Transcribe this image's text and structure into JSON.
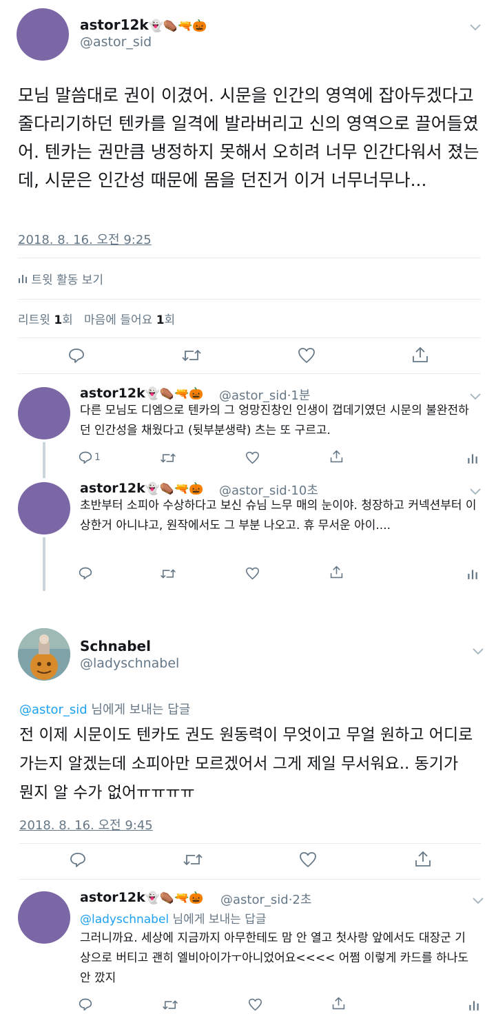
{
  "colors": {
    "accent": "#1da1f2",
    "gray": "#657786",
    "divider": "#e6ecf0",
    "avatar": "#7b66a6"
  },
  "main_tweet": {
    "name": "astor12k",
    "emojis": "👻⚰️🔫🎃",
    "handle": "@astor_sid",
    "text": "모님 말씀대로 권이 이겼어. 시문을 인간의 영역에 잡아두겠다고 줄다리기하던 텐카를 일격에 발라버리고 신의 영역으로 끌어들였어. 텐카는 권만큼 냉정하지 못해서 오히려 너무 인간다워서 졌는데, 시문은 인간성 때문에 몸을 던진거 이거 너무너무나...",
    "timestamp": "2018. 8. 16. 오전 9:25",
    "activity_label": "트윗 활동 보기",
    "retweet_label": "리트윗",
    "retweet_count": "1",
    "retweet_unit": "회",
    "like_label": "마음에 들어요",
    "like_count": "1",
    "like_unit": "회"
  },
  "replies_1": [
    {
      "name": "astor12k",
      "emojis": "👻⚰️🔫🎃",
      "handle": "@astor_sid",
      "time": "1분",
      "text": "다른 모님도 디엠으로 텐카의 그 엉망진창인 인생이 껍데기였던 시문의 불완전하던 인간성을 채웠다고 (뒷부분생략) 츠는 또 구르고.",
      "reply_count": "1"
    },
    {
      "name": "astor12k",
      "emojis": "👻⚰️🔫🎃",
      "handle": "@astor_sid",
      "time": "10초",
      "text": "초반부터 소피아 수상하다고 보신 슈님 느무 매의 눈이야. 청장하고 커넥션부터 이상한거 아니냐고, 원작에서도 그 부분 나오고. 휴 무서운 아이....",
      "reply_count": ""
    }
  ],
  "second_tweet": {
    "name": "Schnabel",
    "handle": "@ladyschnabel",
    "reply_to_handle": "@astor_sid",
    "reply_to_suffix": " 님에게 보내는 답글",
    "text": "전 이제 시문이도 텐카도 권도 원동력이 무엇이고 무얼 원하고 어디로 가는지 알겠는데 소피아만 모르겠어서 그게 제일 무서워요.. 동기가 뭔지 알 수가 없어ㅠㅠㅠㅠ",
    "timestamp": "2018. 8. 16. 오전 9:45"
  },
  "last_reply": {
    "name": "astor12k",
    "emojis": "👻⚰️🔫🎃",
    "handle": "@astor_sid",
    "time": "2초",
    "reply_to_handle": "@ladyschnabel",
    "reply_to_suffix": " 님에게 보내는 답글",
    "text": "그러니까요. 세상에 지금까지 아무한테도 맘 안 열고 첫사랑 앞에서도 대장군 기상으로 버티고 괜히 엘비아이가ㅜ아니었어요<<<< 어쩜 이렇게 카드를 하나도 안 깠지"
  }
}
